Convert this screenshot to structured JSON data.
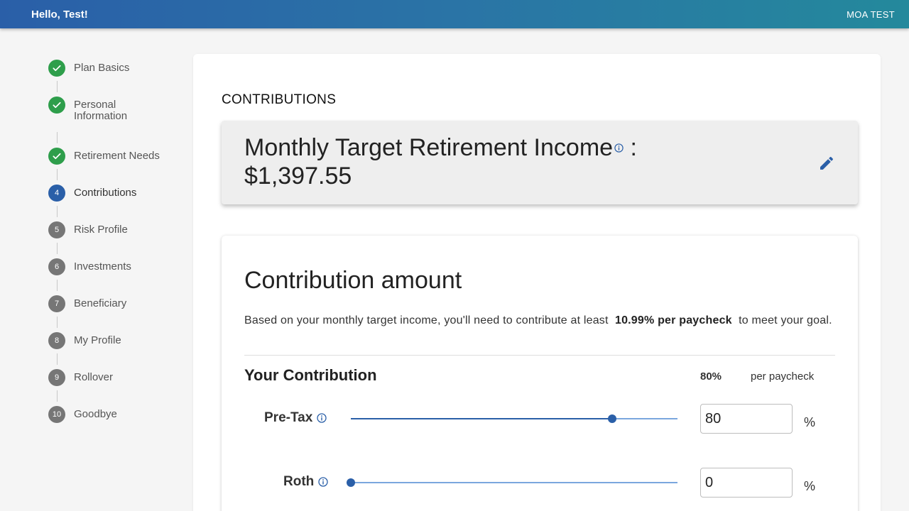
{
  "header": {
    "greeting": "Hello, Test!",
    "user_name": "MOA TEST"
  },
  "steps": [
    {
      "number": "1",
      "label": "Plan Basics",
      "state": "done"
    },
    {
      "number": "2",
      "label": "Personal Information",
      "state": "done"
    },
    {
      "number": "3",
      "label": "Retirement Needs",
      "state": "done"
    },
    {
      "number": "4",
      "label": "Contributions",
      "state": "active"
    },
    {
      "number": "5",
      "label": "Risk Profile",
      "state": "todo"
    },
    {
      "number": "6",
      "label": "Investments",
      "state": "todo"
    },
    {
      "number": "7",
      "label": "Beneficiary",
      "state": "todo"
    },
    {
      "number": "8",
      "label": "My Profile",
      "state": "todo"
    },
    {
      "number": "9",
      "label": "Rollover",
      "state": "todo"
    },
    {
      "number": "10",
      "label": "Goodbye",
      "state": "todo"
    }
  ],
  "main": {
    "section_title": "CONTRIBUTIONS",
    "target": {
      "label": "Monthly Target Retirement Income",
      "separator": " :",
      "amount": "$1,397.55"
    },
    "contribution": {
      "heading": "Contribution amount",
      "text_before": "Based on your monthly target income, you'll need to contribute at least ",
      "text_bold": "10.99% per paycheck",
      "text_after": " to meet your goal.",
      "your_contribution": "Your Contribution",
      "total_percent": "80%",
      "per_paycheck": "per paycheck",
      "pretax": {
        "label": "Pre-Tax",
        "value": "80",
        "unit": "%",
        "slider_fraction": 0.8
      },
      "roth": {
        "label": "Roth",
        "value": "0",
        "unit": "%",
        "slider_fraction": 0.0
      }
    }
  },
  "colors": {
    "primary": "#2a5fa8",
    "success": "#2e9e4b",
    "inactive": "#767676"
  }
}
